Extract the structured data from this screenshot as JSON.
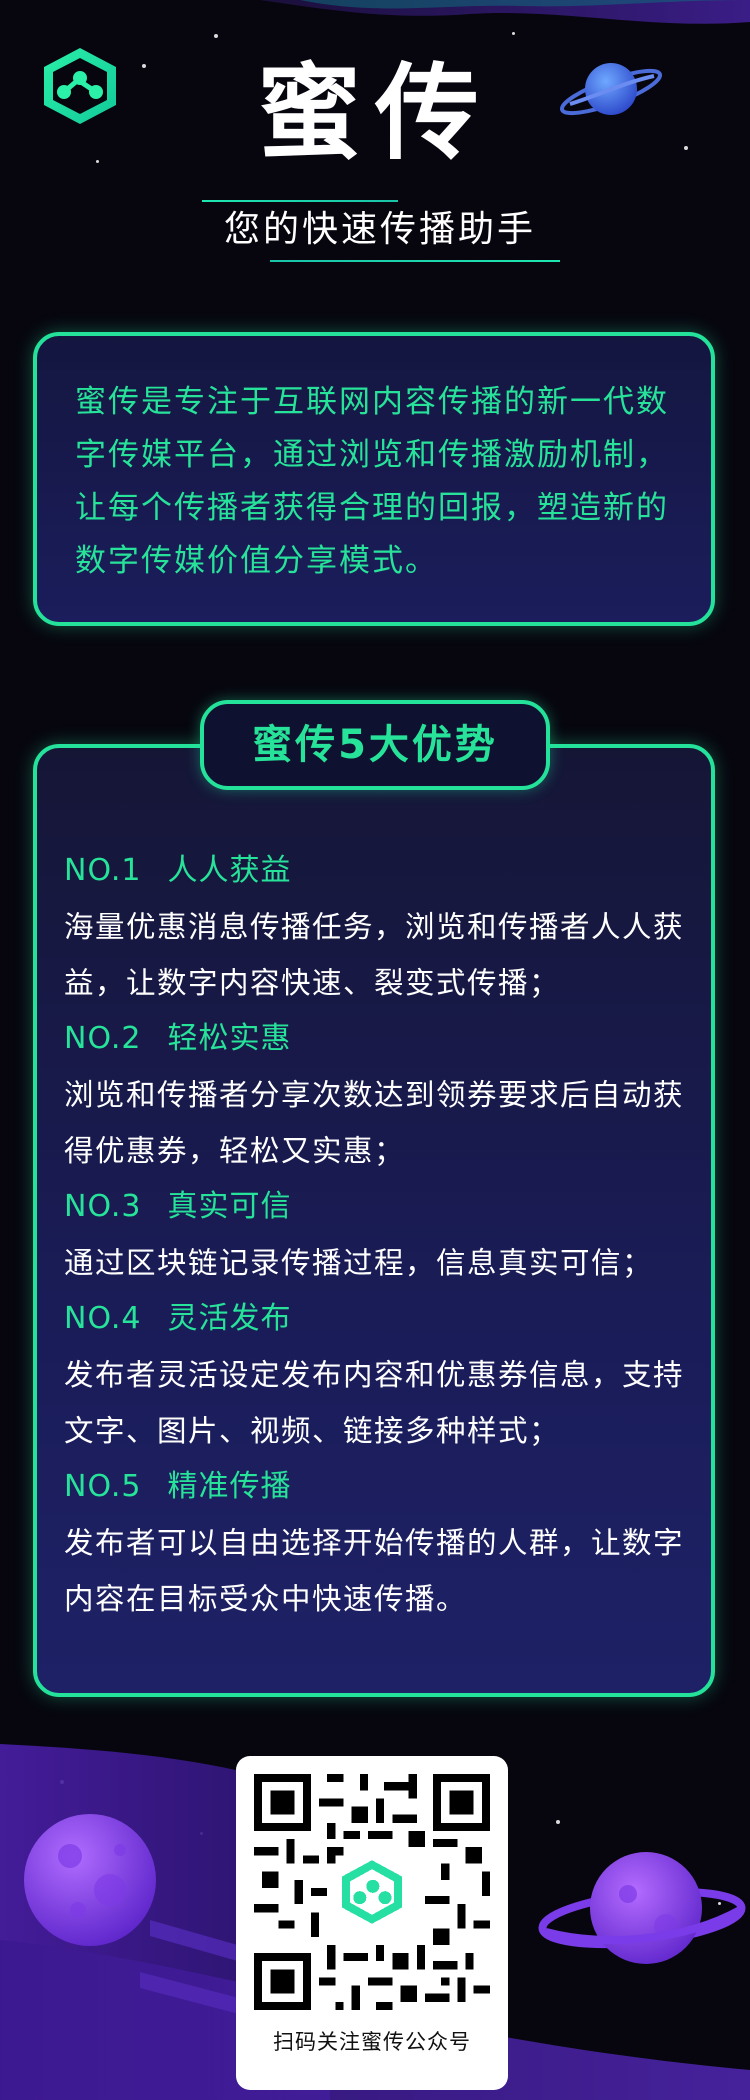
{
  "brand": {
    "title": "蜜传",
    "subtitle": "您的快速传播助手"
  },
  "intro": {
    "text": "蜜传是专注于互联网内容传播的新一代数字传媒平台，通过浏览和传播激励机制，让每个传播者获得合理的回报，塑造新的数字传媒价值分享模式。"
  },
  "advantages": {
    "header": "蜜传5大优势",
    "items": [
      {
        "num": "NO.1",
        "title": "人人获益",
        "desc": "海量优惠消息传播任务，浏览和传播者人人获益，让数字内容快速、裂变式传播；"
      },
      {
        "num": "NO.2",
        "title": "轻松实惠",
        "desc": "浏览和传播者分享次数达到领券要求后自动获得优惠券，轻松又实惠；"
      },
      {
        "num": "NO.3",
        "title": "真实可信",
        "desc": "通过区块链记录传播过程，信息真实可信；"
      },
      {
        "num": "NO.4",
        "title": "灵活发布",
        "desc": "发布者灵活设定发布内容和优惠券信息，支持文字、图片、视频、链接多种样式；"
      },
      {
        "num": "NO.5",
        "title": "精准传播",
        "desc": "发布者可以自由选择开始传播的人群，让数字内容在目标受众中快速传播。"
      }
    ]
  },
  "qr": {
    "caption": "扫码关注蜜传公众号"
  },
  "colors": {
    "accent": "#24e29a",
    "background": "#07060f",
    "panel": "#1b1d5c",
    "purple": "#5b2bc9"
  },
  "icons": {
    "logo": "hexagon-molecule-logo-icon",
    "planet_top": "ringed-planet-icon",
    "planet_left": "moon-planet-icon",
    "planet_right": "ringed-planet-icon",
    "qr": "qr-code-icon"
  }
}
